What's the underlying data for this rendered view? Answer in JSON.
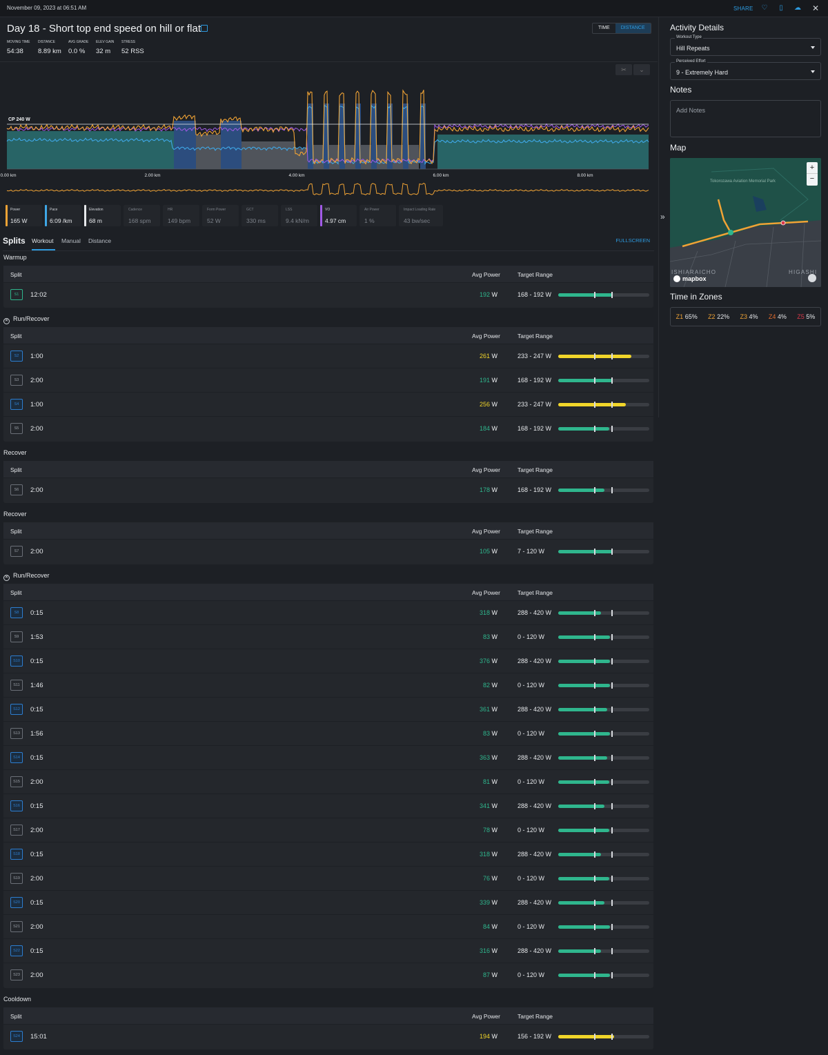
{
  "topbar": {
    "date": "November 09, 2023 at 06:51 AM",
    "share": "SHARE"
  },
  "header": {
    "title": "Day 18 - Short top end speed on hill or flat",
    "toggle_time": "TIME",
    "toggle_distance": "DISTANCE"
  },
  "stats": [
    {
      "label": "Moving Time",
      "value": "54:38"
    },
    {
      "label": "Distance",
      "value": "8.89 km"
    },
    {
      "label": "Avg Grade",
      "value": "0.0 %"
    },
    {
      "label": "Elev Gain",
      "value": "32 m"
    },
    {
      "label": "Stress",
      "value": "52 RSS"
    }
  ],
  "chart": {
    "cp_label": "CP 240 W",
    "x_ticks": [
      "0.00 km",
      "2.00 km",
      "4.00 km",
      "6.00 km",
      "8.00 km"
    ],
    "colors": {
      "power": "#f0a335",
      "pace": "#3fa7e6",
      "vo": "#a25be8",
      "zone": "#2a6c6e"
    }
  },
  "metrics": [
    {
      "label": "Power",
      "value": "165 W",
      "color": "#f0a335"
    },
    {
      "label": "Pace",
      "value": "6:09 /km",
      "color": "#3fa7e6"
    },
    {
      "label": "Elevation",
      "value": "68 m",
      "color": "#e6e8eb"
    },
    {
      "label": "Cadence",
      "value": "168 spm"
    },
    {
      "label": "HR",
      "value": "149 bpm"
    },
    {
      "label": "Form Power",
      "value": "52 W"
    },
    {
      "label": "GCT",
      "value": "330 ms"
    },
    {
      "label": "LSS",
      "value": "9.4 kN/m"
    },
    {
      "label": "VO",
      "value": "4.97 cm",
      "color": "#a25be8"
    },
    {
      "label": "Air Power",
      "value": "1 %"
    },
    {
      "label": "Impact Loading Rate",
      "value": "43 bw/sec"
    }
  ],
  "splits": {
    "title": "Splits",
    "tabs": [
      "Workout",
      "Manual",
      "Distance"
    ],
    "fullscreen": "FULLSCREEN",
    "col_split": "Split",
    "col_power": "Avg Power",
    "col_range": "Target Range",
    "unit": "W",
    "sections": [
      {
        "name": "Warmup",
        "x": false,
        "rows": [
          {
            "id": "S1",
            "dur": "12:02",
            "power": "192",
            "range": "168 - 192 W",
            "fill": 0.6,
            "color": "green",
            "type": "g"
          }
        ]
      },
      {
        "name": "Run/Recover",
        "x": true,
        "rows": [
          {
            "id": "S2",
            "dur": "1:00",
            "power": "261",
            "range": "233 - 247 W",
            "fill": 0.8,
            "color": "yellow",
            "type": "b"
          },
          {
            "id": "S3",
            "dur": "2:00",
            "power": "191",
            "range": "168 - 192 W",
            "fill": 0.6,
            "color": "green",
            "type": "n"
          },
          {
            "id": "S4",
            "dur": "1:00",
            "power": "256",
            "range": "233 - 247 W",
            "fill": 0.74,
            "color": "yellow",
            "type": "b"
          },
          {
            "id": "S5",
            "dur": "2:00",
            "power": "184",
            "range": "168 - 192 W",
            "fill": 0.56,
            "color": "green",
            "type": "n"
          }
        ]
      },
      {
        "name": "Recover",
        "x": false,
        "rows": [
          {
            "id": "S6",
            "dur": "2:00",
            "power": "178",
            "range": "168 - 192 W",
            "fill": 0.51,
            "color": "green",
            "type": "n"
          }
        ]
      },
      {
        "name": "Recover",
        "x": false,
        "rows": [
          {
            "id": "S7",
            "dur": "2:00",
            "power": "105",
            "range": "7 - 120 W",
            "fill": 0.6,
            "color": "green",
            "type": "n"
          }
        ]
      },
      {
        "name": "Run/Recover",
        "x": true,
        "rows": [
          {
            "id": "S8",
            "dur": "0:15",
            "power": "318",
            "range": "288 - 420 W",
            "fill": 0.47,
            "color": "green",
            "type": "b"
          },
          {
            "id": "S9",
            "dur": "1:53",
            "power": "83",
            "range": "0 - 120 W",
            "fill": 0.57,
            "color": "green",
            "type": "n"
          },
          {
            "id": "S10",
            "dur": "0:15",
            "power": "376",
            "range": "288 - 420 W",
            "fill": 0.57,
            "color": "green",
            "type": "b"
          },
          {
            "id": "S11",
            "dur": "1:46",
            "power": "82",
            "range": "0 - 120 W",
            "fill": 0.57,
            "color": "green",
            "type": "n"
          },
          {
            "id": "S12",
            "dur": "0:15",
            "power": "361",
            "range": "288 - 420 W",
            "fill": 0.54,
            "color": "green",
            "type": "b"
          },
          {
            "id": "S13",
            "dur": "1:56",
            "power": "83",
            "range": "0 - 120 W",
            "fill": 0.57,
            "color": "green",
            "type": "n"
          },
          {
            "id": "S14",
            "dur": "0:15",
            "power": "363",
            "range": "288 - 420 W",
            "fill": 0.54,
            "color": "green",
            "type": "b"
          },
          {
            "id": "S15",
            "dur": "2:00",
            "power": "81",
            "range": "0 - 120 W",
            "fill": 0.56,
            "color": "green",
            "type": "n"
          },
          {
            "id": "S16",
            "dur": "0:15",
            "power": "341",
            "range": "288 - 420 W",
            "fill": 0.51,
            "color": "green",
            "type": "b"
          },
          {
            "id": "S17",
            "dur": "2:00",
            "power": "78",
            "range": "0 - 120 W",
            "fill": 0.56,
            "color": "green",
            "type": "n"
          },
          {
            "id": "S18",
            "dur": "0:15",
            "power": "318",
            "range": "288 - 420 W",
            "fill": 0.47,
            "color": "green",
            "type": "b"
          },
          {
            "id": "S19",
            "dur": "2:00",
            "power": "76",
            "range": "0 - 120 W",
            "fill": 0.56,
            "color": "green",
            "type": "n"
          },
          {
            "id": "S20",
            "dur": "0:15",
            "power": "339",
            "range": "288 - 420 W",
            "fill": 0.51,
            "color": "green",
            "type": "b"
          },
          {
            "id": "S21",
            "dur": "2:00",
            "power": "84",
            "range": "0 - 120 W",
            "fill": 0.57,
            "color": "green",
            "type": "n"
          },
          {
            "id": "S22",
            "dur": "0:15",
            "power": "316",
            "range": "288 - 420 W",
            "fill": 0.47,
            "color": "green",
            "type": "b"
          },
          {
            "id": "S23",
            "dur": "2:00",
            "power": "87",
            "range": "0 - 120 W",
            "fill": 0.57,
            "color": "green",
            "type": "n"
          }
        ]
      },
      {
        "name": "Cooldown",
        "x": false,
        "rows": [
          {
            "id": "S24",
            "dur": "15:01",
            "power": "194",
            "range": "156 - 192 W",
            "fill": 0.61,
            "color": "yellow",
            "type": "b"
          }
        ]
      }
    ]
  },
  "sidebar": {
    "details_title": "Activity Details",
    "workout_type_label": "Workout Type",
    "workout_type_value": "Hill Repeats",
    "effort_label": "Perceived Effort",
    "effort_value": "9 - Extremely Hard",
    "notes_title": "Notes",
    "notes_placeholder": "Add Notes",
    "map_title": "Map",
    "map_park": "Tokorozawa Aviation Memorial Park",
    "map_area_left": "ISHIARAICHO",
    "map_area_right": "HIGASHI",
    "map_brand": "mapbox",
    "zones_title": "Time in Zones",
    "zones": [
      {
        "z": "Z1",
        "pct": "65%",
        "color": "#f0a335"
      },
      {
        "z": "Z2",
        "pct": "22%",
        "color": "#f0a335"
      },
      {
        "z": "Z3",
        "pct": "4%",
        "color": "#f0a335"
      },
      {
        "z": "Z4",
        "pct": "4%",
        "color": "#e36b2c"
      },
      {
        "z": "Z5",
        "pct": "5%",
        "color": "#d9394a"
      }
    ]
  }
}
